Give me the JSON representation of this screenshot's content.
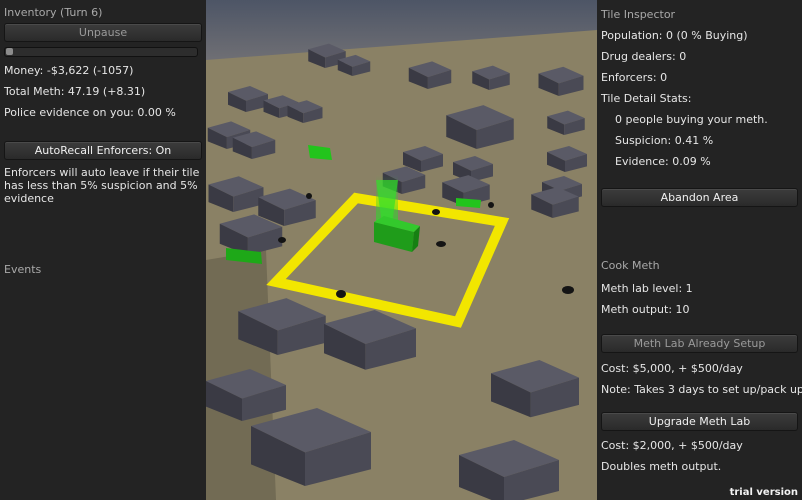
{
  "left": {
    "inventory_title": "Inventory (Turn 6)",
    "unpause_label": "Unpause",
    "speed_level": 0,
    "money": "Money: -$3,622 (-1057)",
    "total_meth": "Total Meth: 47.19 (+8.31)",
    "police_evidence": "Police evidence on you: 0.00 %",
    "autorecall_label": "AutoRecall Enforcers: On",
    "autorecall_note": "Enforcers will auto leave if their tile has less than 5% suspicion and 5% evidence",
    "events_title": "Events"
  },
  "right": {
    "tile_inspector_title": "Tile Inspector",
    "population": "Population: 0 (0 % Buying)",
    "drug_dealers": "Drug dealers: 0",
    "enforcers": "Enforcers: 0",
    "detail_title": "Tile Detail Stats:",
    "people_buying": "0 people buying your meth.",
    "suspicion": "Suspicion: 0.41 %",
    "evidence": "Evidence: 0.09 %",
    "abandon_label": "Abandon Area",
    "cook_title": "Cook Meth",
    "lab_level": "Meth lab level: 1",
    "meth_output": "Meth output: 10",
    "setup_label": "Meth Lab Already Setup",
    "setup_cost": "Cost: $5,000, + $500/day",
    "setup_note": "Note: Takes 3 days to set up/pack up.",
    "upgrade_label": "Upgrade Meth Lab",
    "upgrade_cost": "Cost: $2,000, + $500/day",
    "upgrade_note": "Doubles meth output."
  },
  "watermark": "trial version",
  "colors": {
    "ground": "#8a8165",
    "building": "#4a4a55",
    "highlight": "#f2e600",
    "car": "#25c51e",
    "panel": "#232323"
  }
}
